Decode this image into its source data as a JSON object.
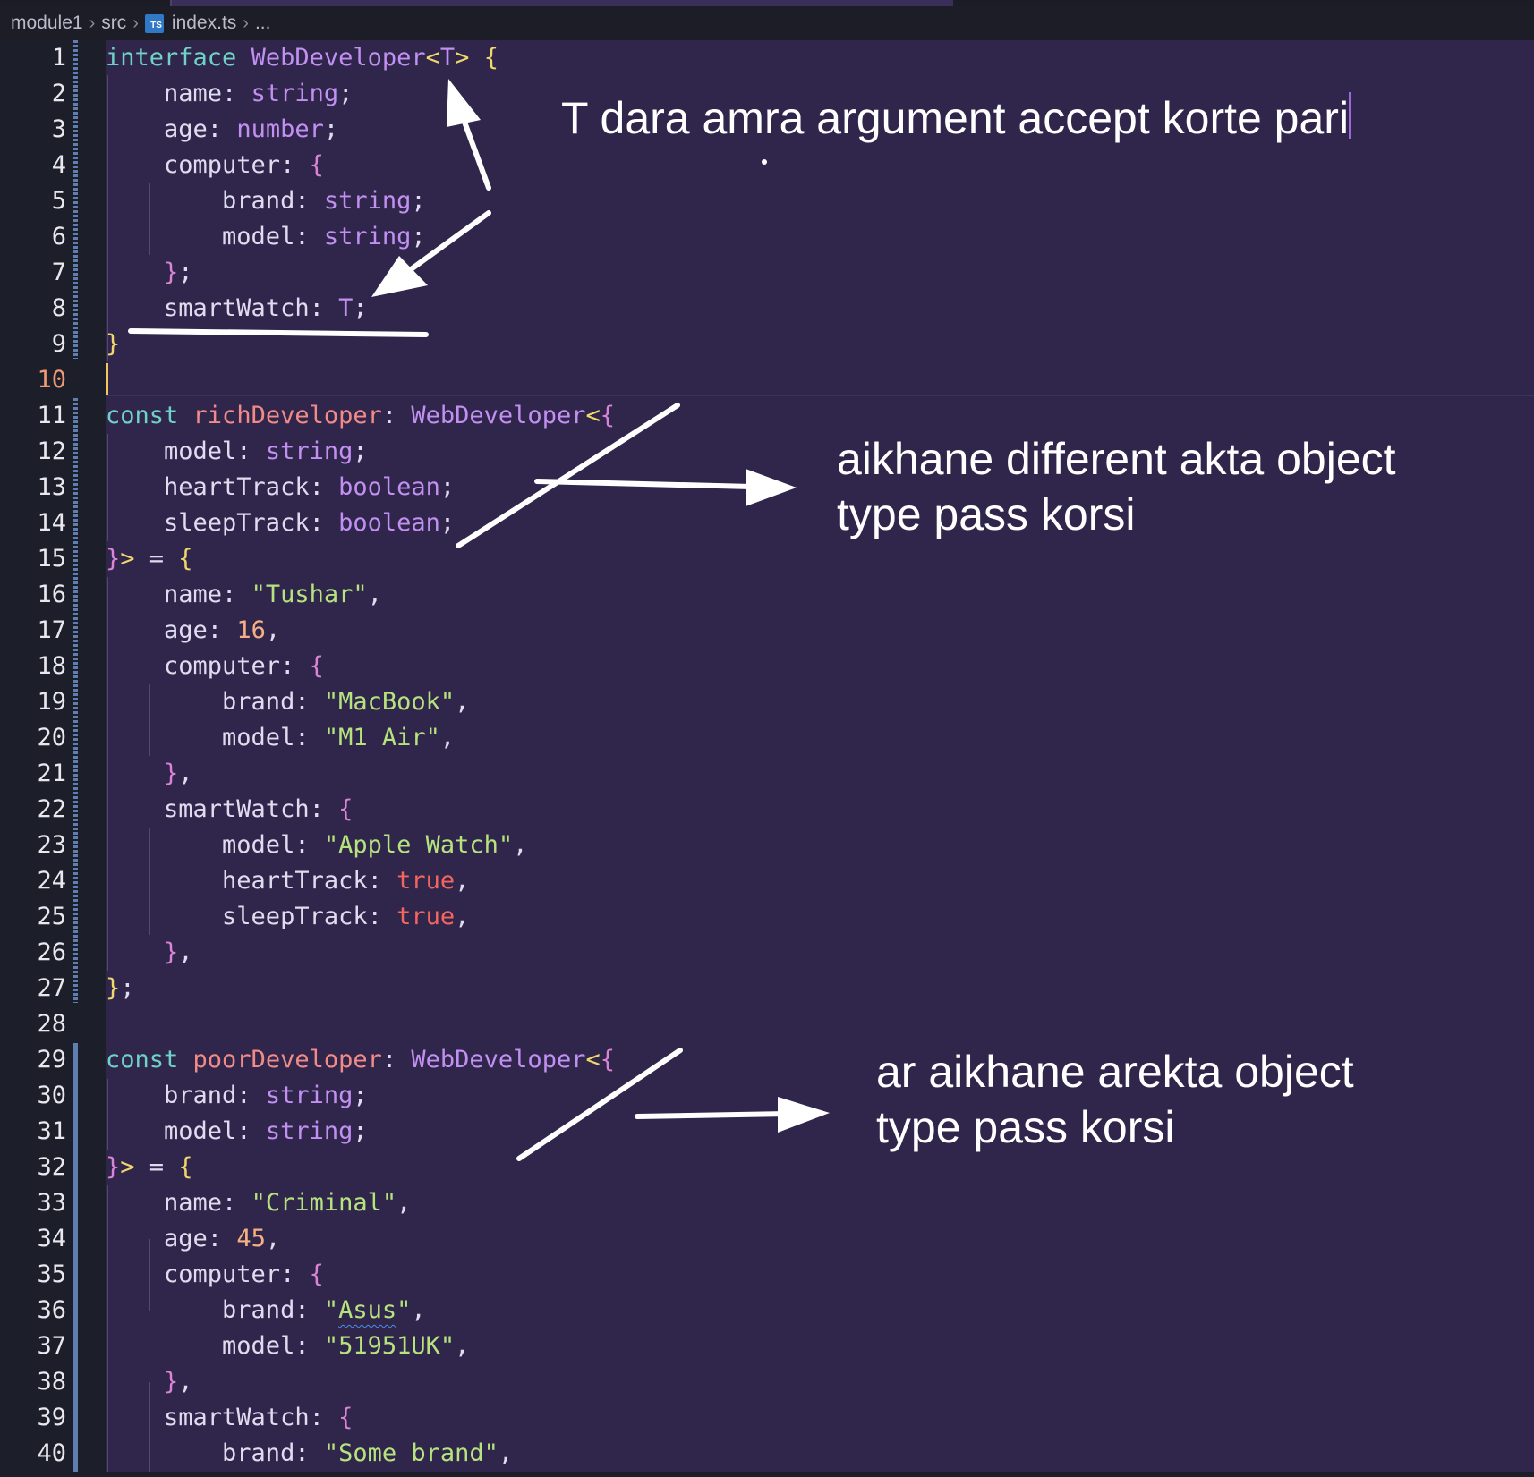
{
  "breadcrumb": {
    "folder1": "module1",
    "folder2": "src",
    "file_icon": "ts-file-icon",
    "file_icon_text": "TS",
    "file": "index.ts",
    "more": "..."
  },
  "editor": {
    "current_line": 10,
    "lines": [
      [
        [
          "interface ",
          "k"
        ],
        [
          "WebDeveloper",
          "t"
        ],
        [
          "<",
          "b1"
        ],
        [
          "T",
          "t"
        ],
        [
          "> ",
          "b1"
        ],
        [
          "{",
          "b1"
        ]
      ],
      [
        [
          "    name: ",
          "p"
        ],
        [
          "string",
          "t"
        ],
        [
          ";",
          "p"
        ]
      ],
      [
        [
          "    age: ",
          "p"
        ],
        [
          "number",
          "t"
        ],
        [
          ";",
          "p"
        ]
      ],
      [
        [
          "    computer: ",
          "p"
        ],
        [
          "{",
          "b2"
        ]
      ],
      [
        [
          "        brand: ",
          "p"
        ],
        [
          "string",
          "t"
        ],
        [
          ";",
          "p"
        ]
      ],
      [
        [
          "        model: ",
          "p"
        ],
        [
          "string",
          "t"
        ],
        [
          ";",
          "p"
        ]
      ],
      [
        [
          "    ",
          "p"
        ],
        [
          "}",
          "b2"
        ],
        [
          ";",
          "p"
        ]
      ],
      [
        [
          "    smartWatch: ",
          "p"
        ],
        [
          "T",
          "t"
        ],
        [
          ";",
          "p"
        ]
      ],
      [
        [
          "}",
          "b1"
        ]
      ],
      [],
      [
        [
          "const ",
          "k"
        ],
        [
          "richDeveloper",
          "v"
        ],
        [
          ": ",
          "p"
        ],
        [
          "WebDeveloper",
          "t"
        ],
        [
          "<",
          "b1"
        ],
        [
          "{",
          "b2"
        ]
      ],
      [
        [
          "    model: ",
          "p"
        ],
        [
          "string",
          "t"
        ],
        [
          ";",
          "p"
        ]
      ],
      [
        [
          "    heartTrack: ",
          "p"
        ],
        [
          "boolean",
          "t"
        ],
        [
          ";",
          "p"
        ]
      ],
      [
        [
          "    sleepTrack: ",
          "p"
        ],
        [
          "boolean",
          "t"
        ],
        [
          ";",
          "p"
        ]
      ],
      [
        [
          "}",
          "b2"
        ],
        [
          "> ",
          "b1"
        ],
        [
          "= ",
          "p"
        ],
        [
          "{",
          "b1"
        ]
      ],
      [
        [
          "    name: ",
          "p"
        ],
        [
          "\"Tushar\"",
          "s"
        ],
        [
          ",",
          "p"
        ]
      ],
      [
        [
          "    age: ",
          "p"
        ],
        [
          "16",
          "n"
        ],
        [
          ",",
          "p"
        ]
      ],
      [
        [
          "    computer: ",
          "p"
        ],
        [
          "{",
          "b2"
        ]
      ],
      [
        [
          "        brand: ",
          "p"
        ],
        [
          "\"MacBook\"",
          "s"
        ],
        [
          ",",
          "p"
        ]
      ],
      [
        [
          "        model: ",
          "p"
        ],
        [
          "\"M1 Air\"",
          "s"
        ],
        [
          ",",
          "p"
        ]
      ],
      [
        [
          "    ",
          "p"
        ],
        [
          "}",
          "b2"
        ],
        [
          ",",
          "p"
        ]
      ],
      [
        [
          "    smartWatch: ",
          "p"
        ],
        [
          "{",
          "b2"
        ]
      ],
      [
        [
          "        model: ",
          "p"
        ],
        [
          "\"Apple Watch\"",
          "s"
        ],
        [
          ",",
          "p"
        ]
      ],
      [
        [
          "        heartTrack: ",
          "p"
        ],
        [
          "true",
          "bo"
        ],
        [
          ",",
          "p"
        ]
      ],
      [
        [
          "        sleepTrack: ",
          "p"
        ],
        [
          "true",
          "bo"
        ],
        [
          ",",
          "p"
        ]
      ],
      [
        [
          "    ",
          "p"
        ],
        [
          "}",
          "b2"
        ],
        [
          ",",
          "p"
        ]
      ],
      [
        [
          "}",
          "b1"
        ],
        [
          ";",
          "p"
        ]
      ],
      [],
      [
        [
          "const ",
          "k"
        ],
        [
          "poorDeveloper",
          "v"
        ],
        [
          ": ",
          "p"
        ],
        [
          "WebDeveloper",
          "t"
        ],
        [
          "<",
          "b1"
        ],
        [
          "{",
          "b2"
        ]
      ],
      [
        [
          "    brand: ",
          "p"
        ],
        [
          "string",
          "t"
        ],
        [
          ";",
          "p"
        ]
      ],
      [
        [
          "    model: ",
          "p"
        ],
        [
          "string",
          "t"
        ],
        [
          ";",
          "p"
        ]
      ],
      [
        [
          "}",
          "b2"
        ],
        [
          "> ",
          "b1"
        ],
        [
          "= ",
          "p"
        ],
        [
          "{",
          "b1"
        ]
      ],
      [
        [
          "    name: ",
          "p"
        ],
        [
          "\"Criminal\"",
          "s"
        ],
        [
          ",",
          "p"
        ]
      ],
      [
        [
          "    age: ",
          "p"
        ],
        [
          "45",
          "n"
        ],
        [
          ",",
          "p"
        ]
      ],
      [
        [
          "    computer: ",
          "p"
        ],
        [
          "{",
          "b2"
        ]
      ],
      [
        [
          "        brand: ",
          "p"
        ],
        [
          "\"",
          "s"
        ],
        [
          "Asus",
          "s squig"
        ],
        [
          "\"",
          "s"
        ],
        [
          ",",
          "p"
        ]
      ],
      [
        [
          "        model: ",
          "p"
        ],
        [
          "\"51951UK\"",
          "s"
        ],
        [
          ",",
          "p"
        ]
      ],
      [
        [
          "    ",
          "p"
        ],
        [
          "}",
          "b2"
        ],
        [
          ",",
          "p"
        ]
      ],
      [
        [
          "    smartWatch: ",
          "p"
        ],
        [
          "{",
          "b2"
        ]
      ],
      [
        [
          "        brand: ",
          "p"
        ],
        [
          "\"Some brand\"",
          "s"
        ],
        [
          ",",
          "p"
        ]
      ]
    ]
  },
  "annotations": {
    "note1": "T dara amra argument accept korte pari",
    "note2_line1": "aikhane different akta object",
    "note2_line2": "type pass korsi",
    "note3_line1": "ar aikhane arekta object",
    "note3_line2": "type pass korsi"
  },
  "colors": {
    "background": "#30264c",
    "gutter": "#1c1e29",
    "keyword": "#6fd2c6",
    "type": "#c190f0",
    "variable": "#f18b87",
    "string": "#b6e37e",
    "number": "#f5b083",
    "boolean": "#f2665e",
    "annotation": "#ffffff"
  }
}
